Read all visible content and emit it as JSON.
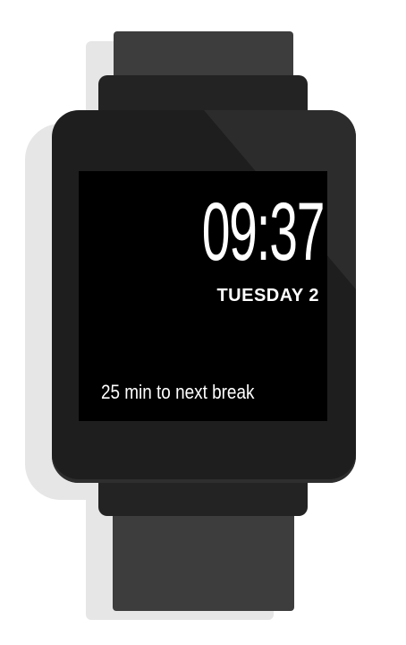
{
  "watch_face": {
    "time": "09:37",
    "date": "TUESDAY 2",
    "status": "25 min to next break"
  },
  "colors": {
    "strap": "#3d3d3d",
    "case": "#1e1e1e",
    "screen": "#000000",
    "text": "#ffffff",
    "shadow": "#e6e6e6"
  }
}
